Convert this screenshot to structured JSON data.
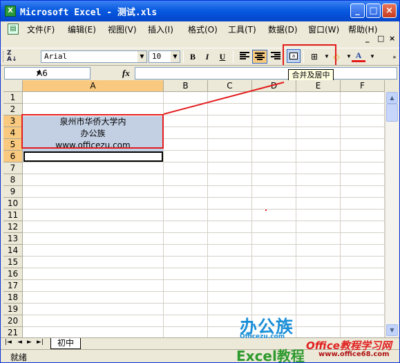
{
  "window": {
    "title": "Microsoft Excel - 测试.xls",
    "app_icon": "X",
    "buttons": {
      "minimize": "_",
      "maximize": "□",
      "close": "×"
    }
  },
  "menu": {
    "items": [
      "文件(F)",
      "编辑(E)",
      "视图(V)",
      "插入(I)",
      "格式(O)",
      "工具(T)",
      "数据(D)",
      "窗口(W)",
      "帮助(H)"
    ],
    "doc_controls": [
      "_",
      "□",
      "×"
    ]
  },
  "toolbar": {
    "font_name": "Arial",
    "font_size": "10",
    "bold": "B",
    "italic": "I",
    "underline": "U",
    "font_color_label": "A",
    "merge_tooltip": "合并及居中"
  },
  "formula_bar": {
    "name_box": "A6",
    "fx": "fx",
    "formula": ""
  },
  "sheet": {
    "columns": [
      "A",
      "B",
      "C",
      "D",
      "E",
      "F"
    ],
    "selected_column": "A",
    "rows": [
      "1",
      "2",
      "3",
      "4",
      "5",
      "6",
      "7",
      "8",
      "9",
      "10",
      "11",
      "12",
      "13",
      "14",
      "15",
      "16",
      "17",
      "18",
      "19",
      "20",
      "21"
    ],
    "selected_rows": [
      "3",
      "4",
      "5",
      "6"
    ],
    "cells": {
      "A3": "泉州市华侨大学内",
      "A4": "办公族",
      "A5": "www.officezu.com"
    },
    "active_cell": "A6",
    "tab_name": "初中"
  },
  "status": {
    "text": "就绪"
  },
  "watermark": {
    "logo_text": "办公族",
    "logo_sub": "Officezu.com",
    "tutorial": "Excel教程",
    "site_title": "Office教程学习网",
    "site_url": "www.office68.com"
  }
}
